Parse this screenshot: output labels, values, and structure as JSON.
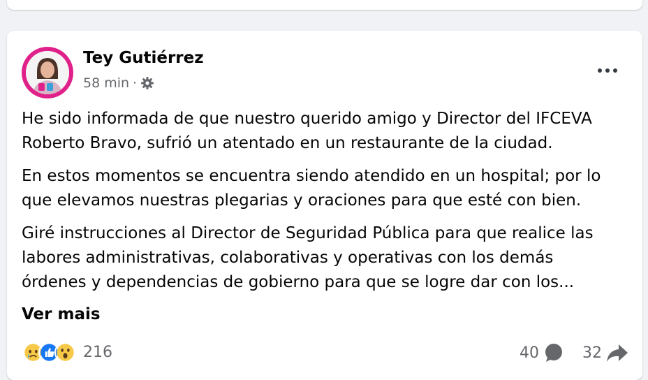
{
  "post": {
    "author": "Tey Gutiérrez",
    "time": "58 min",
    "separator": "·",
    "audience_icon": "gear-icon",
    "menu_icon": "more-options-icon",
    "paragraphs": [
      "He sido informada de que nuestro querido amigo y Director del IFCEVA",
      "Roberto Bravo, sufrió un atentado en un restaurante de la ciudad.",
      "En estos momentos se encuentra siendo atendido en un hospital; por lo",
      "que elevamos nuestras plegarias y oraciones para que esté con bien.",
      "Giré instrucciones al Director de Seguridad Pública para que realice las",
      "labores administrativas, colaborativas y operativas con los demás",
      "órdenes y dependencias de gobierno para que se logre dar con los..."
    ],
    "see_more": "Ver mais",
    "reactions": {
      "icons": [
        "sad-reaction-icon",
        "like-reaction-icon",
        "wow-reaction-icon"
      ],
      "count": "216"
    },
    "comments": {
      "count": "40",
      "icon": "comment-icon"
    },
    "shares": {
      "count": "32",
      "icon": "share-icon"
    }
  },
  "colors": {
    "avatar_ring": "#e0218a",
    "like_blue": "#1877f2",
    "emoji_yellow": "#f7c948",
    "secondary_text": "#65676b"
  }
}
